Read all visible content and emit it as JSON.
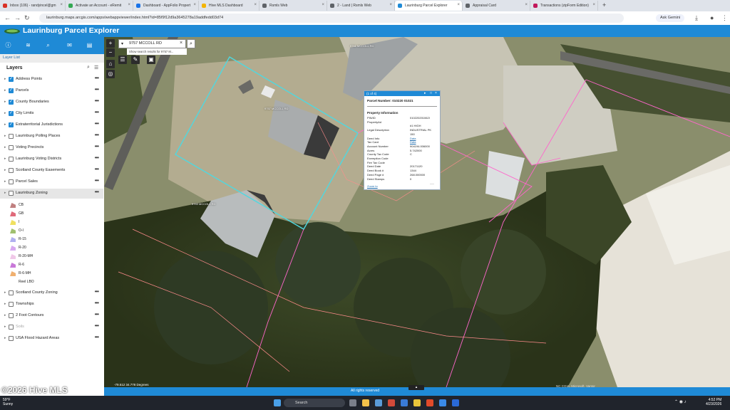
{
  "browser": {
    "tabs": [
      {
        "label": "Inbox (106) - randyincel@gm",
        "color": "#d93025",
        "active": false
      },
      {
        "label": "Activate an Account - eRemit",
        "color": "#34a853",
        "active": false
      },
      {
        "label": "Dashboard - AppFolio Propert",
        "color": "#1a73e8",
        "active": false
      },
      {
        "label": "Hive MLS Dashboard",
        "color": "#f4b400",
        "active": false
      },
      {
        "label": "Rsmls Web",
        "color": "#5f6368",
        "active": false
      },
      {
        "label": "2 - Land | Rsmls Web",
        "color": "#5f6368",
        "active": false
      },
      {
        "label": "Laurinburg Parcel Explorer",
        "color": "#1f8ad6",
        "active": true
      },
      {
        "label": "Appraisal Card",
        "color": "#5f6368",
        "active": false
      },
      {
        "label": "Transactions (zipForm Edition)",
        "color": "#c2185b",
        "active": false
      }
    ],
    "url": "laurinburg.maps.arcgis.com/apps/webappviewer/index.html?id=85f9f12d9a3645278a19addfedd03d74",
    "gemini_label": "Ask Gemini"
  },
  "app": {
    "title": "Laurinburg Parcel Explorer",
    "footer_text": "All rights reserved",
    "watermark": "©2026 Hive MLS",
    "attribution": "NC CGIA, Microsoft, Vantor",
    "coordinates": "-79.512 34.778 Degrees"
  },
  "panel": {
    "tab_label": "Layer List",
    "title": "Layers",
    "layers": [
      {
        "label": "Address Points",
        "checked": true,
        "dim": false
      },
      {
        "label": "Parcels",
        "checked": true,
        "dim": false
      },
      {
        "label": "County Boundaries",
        "checked": true,
        "dim": false
      },
      {
        "label": "City Limits",
        "checked": true,
        "dim": false
      },
      {
        "label": "Extraterritorial Jurisdictions",
        "checked": true,
        "dim": false
      },
      {
        "label": "Laurinburg Polling Places",
        "checked": false,
        "dim": false
      },
      {
        "label": "Voting Precincts",
        "checked": false,
        "dim": false
      },
      {
        "label": "Laurinburg Voting Districts",
        "checked": false,
        "dim": false
      },
      {
        "label": "Scotland County Easements",
        "checked": false,
        "dim": false
      },
      {
        "label": "Parcel Sales",
        "checked": false,
        "dim": false
      },
      {
        "label": "Laurinburg Zoning",
        "checked": false,
        "dim": false
      }
    ],
    "zoning_legend": [
      {
        "label": "CB",
        "color": "#c08080"
      },
      {
        "label": "GB",
        "color": "#e06a7a"
      },
      {
        "label": "I",
        "color": "#f0e060"
      },
      {
        "label": "O-I",
        "color": "#a0c070"
      },
      {
        "label": "R-15",
        "color": "#b0b0f0"
      },
      {
        "label": "R-20",
        "color": "#d8a8f0"
      },
      {
        "label": "R-20-MH",
        "color": "#f0c8e8"
      },
      {
        "label": "R-6",
        "color": "#c878d8"
      },
      {
        "label": "R-6-MH",
        "color": "#f0b070"
      },
      {
        "label": "Reel LBO",
        "color": ""
      }
    ],
    "layers_after": [
      {
        "label": "Scotland County Zoning",
        "checked": false,
        "dim": false
      },
      {
        "label": "Townships",
        "checked": false,
        "dim": false
      },
      {
        "label": "2 Foot Contours",
        "checked": false,
        "dim": false
      },
      {
        "label": "Soils",
        "checked": false,
        "dim": true
      },
      {
        "label": "USA Flood Hazard Areas",
        "checked": false,
        "dim": false
      }
    ]
  },
  "map": {
    "search_value": "9757 MCCOLL RD",
    "search_suggest": "Show search results for 9757 M...",
    "labels": [
      {
        "text": "9761 MCCOLL RD"
      },
      {
        "text": "9757 MCCOLL RD"
      },
      {
        "text": "9753 MCCOLL RD"
      }
    ]
  },
  "popup": {
    "header": "(1 of 4)",
    "title": "Parcel Number: 010220 01021",
    "section": "Property Information",
    "fields": [
      {
        "k": "PIN/ID",
        "v": "010220201062I",
        "link": false
      },
      {
        "k": "PropertyAd",
        "v": "",
        "link": false
      },
      {
        "k": "",
        "v": "#1 HIGH",
        "link": false
      },
      {
        "k": "Legal Description",
        "v": "INDUSTRIAL PK",
        "link": false
      },
      {
        "k": "",
        "v": "150",
        "link": false
      },
      {
        "k": "Deed Info",
        "v": "Data",
        "link": true
      },
      {
        "k": "Tax Card",
        "v": "Data",
        "link": true
      },
      {
        "k": "Account Number",
        "v": "904194.006000",
        "link": false
      },
      {
        "k": "Acres",
        "v": "5.742000",
        "link": false
      },
      {
        "k": "County Tax Code",
        "v": "C",
        "link": false
      },
      {
        "k": "Exemption Code",
        "v": "",
        "link": false
      },
      {
        "k": "Fire Tax Code",
        "v": "",
        "link": false
      },
      {
        "k": "Deed Date",
        "v": "20171120",
        "link": false
      },
      {
        "k": "Deed Book #",
        "v": "1344",
        "link": false
      },
      {
        "k": "Deed Page #",
        "v": "268.000000",
        "link": false
      },
      {
        "k": "Deed Stamps",
        "v": "0",
        "link": false
      }
    ],
    "zoom_to": "Zoom to"
  },
  "taskbar": {
    "weather_temp": "59°F",
    "weather_desc": "Sunny",
    "search_placeholder": "Search",
    "time": "4:52 PM",
    "date": "4/23/2026"
  }
}
